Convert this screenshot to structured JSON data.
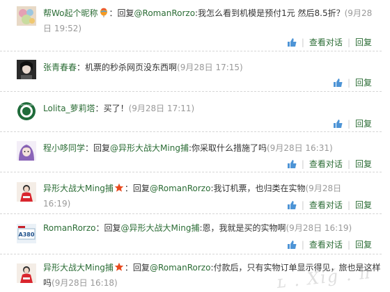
{
  "comments": [
    {
      "user": "帮Wo起个昵称",
      "badge": "balloon-icon",
      "prefix": "：回复",
      "mention": "@RomanRorzo",
      "text": ":我怎么看到机模是预付1元 然后8.5折？",
      "time": "(9月28日 19:52)",
      "avatar": "colorful-avatar",
      "actions": {
        "view_dialog": "查看对话",
        "reply": "回复"
      }
    },
    {
      "user": "张青春春",
      "badge": "",
      "prefix": "：",
      "mention": "",
      "text": "机票的秒杀网页没东西啊",
      "time": "(9月28日 17:15)",
      "avatar": "portrait-avatar",
      "actions": {
        "view_dialog": "",
        "reply": "回复"
      }
    },
    {
      "user": "Lolita_萝莉塔",
      "badge": "",
      "prefix": "：",
      "mention": "",
      "text": "买了！",
      "time": "(9月28日 17:11)",
      "avatar": "coffee-logo-avatar",
      "actions": {
        "view_dialog": "",
        "reply": "回复"
      }
    },
    {
      "user": "程小哆同学",
      "badge": "",
      "prefix": "：回复",
      "mention": "@异形大战大Ming捕",
      "text": ":你采取什么措施了吗",
      "time": "(9月28日 16:31)",
      "avatar": "anime-avatar",
      "actions": {
        "view_dialog": "查看对话",
        "reply": "回复"
      }
    },
    {
      "user": "异形大战大Ming捕",
      "badge": "star-icon",
      "prefix": "：回复",
      "mention": "@RomanRorzo",
      "text": ":我订机票，也归类在实物",
      "time": "(9月28日 16:19)",
      "avatar": "red-figure-avatar",
      "actions": {
        "view_dialog": "查看对话",
        "reply": "回复"
      }
    },
    {
      "user": "RomanRorzo",
      "badge": "",
      "prefix": "：回复",
      "mention": "@异形大战大Ming捕",
      "text": ":恩，我就是买的实物啊",
      "time": "(9月28日 16:19)",
      "avatar": "a380-avatar",
      "actions": {
        "view_dialog": "查看对话",
        "reply": "回复"
      }
    },
    {
      "user": "异形大战大Ming捕",
      "badge": "star-icon",
      "prefix": "：回复",
      "mention": "@RomanRorzo",
      "text": ":付款后，只有实物订单显示得见，旅也是这样吗",
      "time": "(9月28日 16:18)",
      "avatar": "red-figure-avatar",
      "actions": {
        "view_dialog": "",
        "reply": ""
      }
    }
  ],
  "icons": {
    "like": "thumbs-up-icon"
  },
  "colors": {
    "link": "#2b6c35",
    "time": "#999999",
    "separator": "#cccccc"
  }
}
